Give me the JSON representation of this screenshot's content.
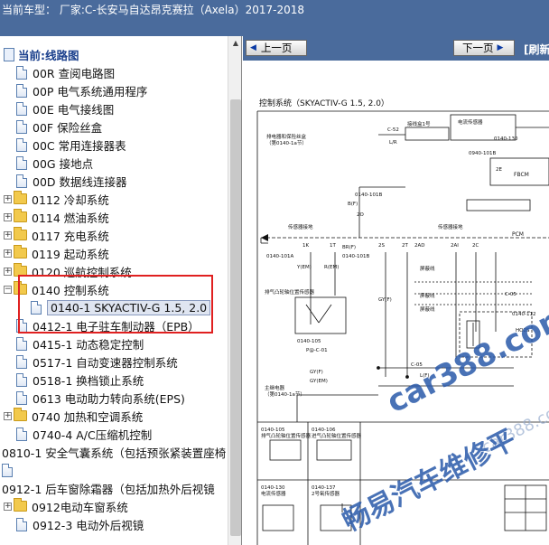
{
  "header": {
    "title": "当前车型：  厂家:C-长安马自达昂克赛拉（Axela）2017-2018"
  },
  "tree": {
    "root_label": "当前:线路图",
    "items": [
      {
        "label": "00R 查阅电路图",
        "kind": "doc"
      },
      {
        "label": "00P 电气系统通用程序",
        "kind": "doc"
      },
      {
        "label": "00E 电气接线图",
        "kind": "doc"
      },
      {
        "label": "00F 保险丝盒",
        "kind": "doc"
      },
      {
        "label": "00C 常用连接器表",
        "kind": "doc"
      },
      {
        "label": "00G 接地点",
        "kind": "doc"
      },
      {
        "label": "00D 数据线连接器",
        "kind": "doc"
      },
      {
        "label": "0112 冷却系统",
        "kind": "folder"
      },
      {
        "label": "0114 燃油系统",
        "kind": "folder"
      },
      {
        "label": "0117 充电系统",
        "kind": "folder"
      },
      {
        "label": "0119 起动系统",
        "kind": "folder"
      },
      {
        "label": "0120 巡航控制系统",
        "kind": "folder"
      },
      {
        "label": "0140 控制系统",
        "kind": "folder-open"
      },
      {
        "label": "0140-1 SKYACTIV-G 1.5, 2.0",
        "kind": "doc-selected"
      },
      {
        "label": "0412-1 电子驻车制动器（EPB）",
        "kind": "doc"
      },
      {
        "label": "0415-1 动态稳定控制",
        "kind": "doc"
      },
      {
        "label": "0517-1 自动变速器控制系统",
        "kind": "doc"
      },
      {
        "label": "0518-1 换档锁止系统",
        "kind": "doc"
      },
      {
        "label": "0613 电动助力转向系统(EPS)",
        "kind": "doc"
      },
      {
        "label": "0740 加热和空调系统",
        "kind": "folder"
      },
      {
        "label": "0740-4 A/C压缩机控制",
        "kind": "doc"
      },
      {
        "label": "0810-1 安全气囊系统（包括预张紧装置座椅",
        "kind": "doc"
      },
      {
        "label": "0912-1 后车窗除霜器（包括加热外后视镜",
        "kind": "doc"
      },
      {
        "label": "0912电动车窗系统",
        "kind": "folder"
      },
      {
        "label": "0912-3 电动外后视镜",
        "kind": "doc"
      }
    ]
  },
  "toolbar": {
    "prev_label": "上一页",
    "next_label": "下一页",
    "refresh_label": "[刷新"
  },
  "diagram": {
    "title": "控制系统（SKYACTIV-G 1.5, 2.0）",
    "labels": {
      "sensor_top": "电流传感器",
      "harness": "接线盒1号",
      "ground_relay": "排电器和保险丝盒",
      "see_ref": "（第0140-1a节）",
      "c52": "C-52",
      "c01": "C-01",
      "c01_130": "0140-130",
      "l_r": "L/R",
      "c_0940": "0940-101B",
      "pcm": "PCM",
      "fbcm": "FBCM",
      "sensor_gnd": "传感器接地",
      "c_101a": "0140-101A",
      "c_101b": "0140-101B",
      "shield1": "屏蔽线",
      "shield2": "屏蔽线",
      "shield3": "屏蔽线",
      "cam_sensor": "排气凸轮轴位置传感器",
      "c_105": "0140-105",
      "c_05": "C-05",
      "c_112": "0140-112",
      "ho2s": "HO2S",
      "main_relay": "主继电器",
      "c_106": "0140-106",
      "c_106_desc": "进气凸轮轴位置传感器",
      "c_105_desc": "排气凸轮轴位置传感器",
      "c_130": "0140-130",
      "c_130_desc": "电流传感器",
      "c_137": "0140-137",
      "c_137_desc": "2号氧传感器",
      "pin_1k": "1K",
      "pin_1t": "1T",
      "pin_2s": "2S",
      "pin_2t": "2T",
      "pin_2ad": "2AD",
      "pin_2ai": "2AI",
      "pin_2c": "2C",
      "pin_2e": "2E",
      "pin_2o": "2O",
      "w_ye": "Y(EM)",
      "w_re": "R(EM)",
      "w_gyf": "GY(F)",
      "w_brf": "BR(F)",
      "w_bf": "B(F)",
      "w_lf": "L(F)",
      "w_gye": "GY(EM)",
      "w_pbc01": "P@-C-01"
    }
  },
  "watermarks": {
    "site": "car388.com",
    "brand": "畅易汽车维修平",
    "site_small": "car388.com"
  }
}
